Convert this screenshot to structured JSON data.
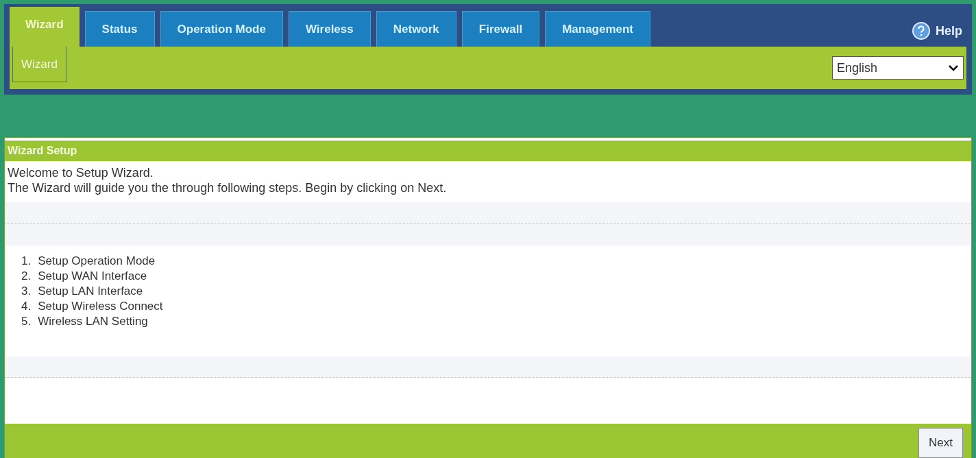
{
  "tabs": [
    {
      "label": "Wizard",
      "selected": true
    },
    {
      "label": "Status",
      "selected": false
    },
    {
      "label": "Operation Mode",
      "selected": false
    },
    {
      "label": "Wireless",
      "selected": false
    },
    {
      "label": "Network",
      "selected": false
    },
    {
      "label": "Firewall",
      "selected": false
    },
    {
      "label": "Management",
      "selected": false
    }
  ],
  "help": {
    "label": "Help"
  },
  "subtabs": [
    {
      "label": "Wizard",
      "selected": true
    }
  ],
  "language": {
    "value": "English"
  },
  "panel": {
    "title": "Wizard Setup",
    "intro": [
      "Welcome to Setup Wizard.",
      "The Wizard will guide you the through following steps. Begin by clicking on Next."
    ],
    "steps": [
      {
        "number": "1.",
        "label": "Setup Operation Mode"
      },
      {
        "number": "2.",
        "label": "Setup WAN Interface"
      },
      {
        "number": "3.",
        "label": "Setup LAN Interface"
      },
      {
        "number": "4.",
        "label": "Setup Wireless Connect"
      },
      {
        "number": "5.",
        "label": "Wireless LAN Setting"
      }
    ],
    "next_button": "Next"
  }
}
